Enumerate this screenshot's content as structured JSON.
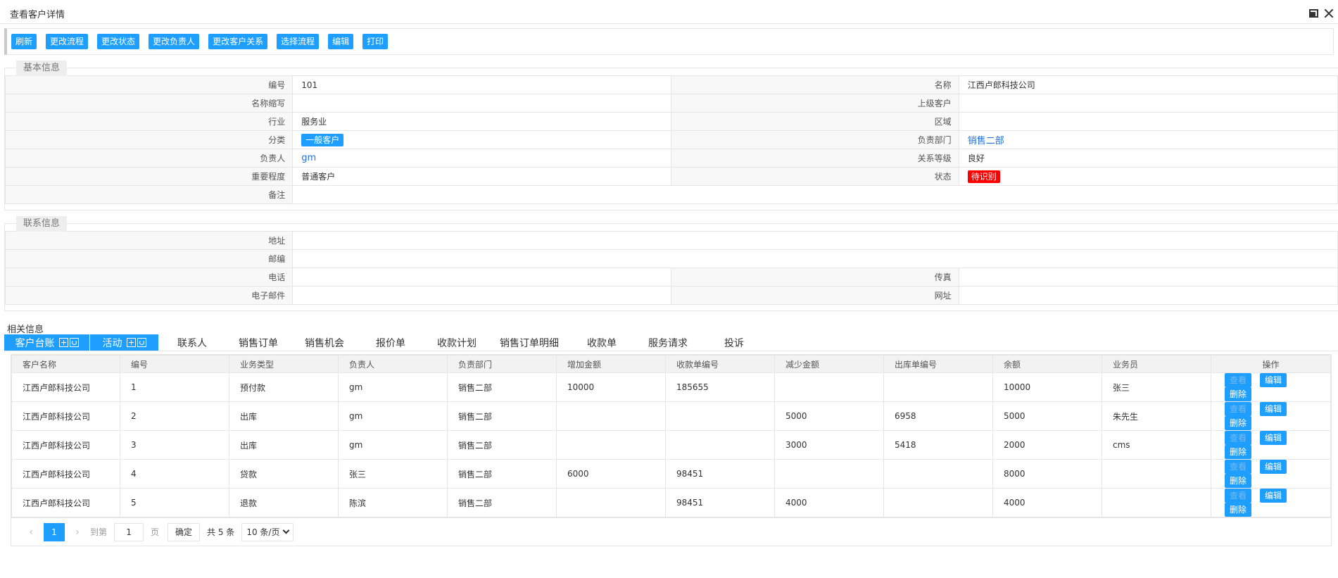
{
  "window": {
    "title": "查看客户详情"
  },
  "toolbar": [
    "刷新",
    "更改流程",
    "更改状态",
    "更改负责人",
    "更改客户关系",
    "选择流程",
    "编辑",
    "打印"
  ],
  "basic": {
    "legend": "基本信息",
    "no_label": "编号",
    "no": "101",
    "name_label": "名称",
    "name": "江西卢郎科技公司",
    "abbr_label": "名称缩写",
    "abbr": "",
    "parent_label": "上级客户",
    "parent": "",
    "industry_label": "行业",
    "industry": "服务业",
    "region_label": "区域",
    "region": "",
    "category_label": "分类",
    "category": "一般客户",
    "dept_label": "负责部门",
    "dept": "销售二部",
    "owner_label": "负责人",
    "owner": "gm",
    "relation_label": "关系等级",
    "relation": "良好",
    "importance_label": "重要程度",
    "importance": "普通客户",
    "status_label": "状态",
    "status": "待识别",
    "remark_label": "备注",
    "remark": ""
  },
  "contact": {
    "legend": "联系信息",
    "address_label": "地址",
    "zip_label": "邮编",
    "phone_label": "电话",
    "fax_label": "传真",
    "email_label": "电子邮件",
    "web_label": "网址"
  },
  "related": {
    "title": "相关信息",
    "tabs": [
      "客户台账",
      "活动",
      "联系人",
      "销售订单",
      "销售机会",
      "报价单",
      "收款计划",
      "销售订单明细",
      "收款单",
      "服务请求",
      "投诉"
    ]
  },
  "grid": {
    "headers": [
      "客户名称",
      "编号",
      "业务类型",
      "负责人",
      "负责部门",
      "增加金额",
      "收款单编号",
      "减少金额",
      "出库单编号",
      "余额",
      "业务员",
      "操作"
    ],
    "rows": [
      [
        "江西卢郎科技公司",
        "1",
        "预付款",
        "gm",
        "销售二部",
        "10000",
        "185655",
        "",
        "",
        "10000",
        "张三"
      ],
      [
        "江西卢郎科技公司",
        "2",
        "出库",
        "gm",
        "销售二部",
        "",
        "",
        "5000",
        "6958",
        "5000",
        "朱先生"
      ],
      [
        "江西卢郎科技公司",
        "3",
        "出库",
        "gm",
        "销售二部",
        "",
        "",
        "3000",
        "5418",
        "2000",
        "cms"
      ],
      [
        "江西卢郎科技公司",
        "4",
        "贷款",
        "张三",
        "销售二部",
        "6000",
        "98451",
        "",
        "",
        "8000",
        ""
      ],
      [
        "江西卢郎科技公司",
        "5",
        "退款",
        "陈滨",
        "销售二部",
        "",
        "98451",
        "4000",
        "",
        "4000",
        ""
      ]
    ],
    "ops": [
      "查看",
      "编辑",
      "删除"
    ]
  },
  "pager": {
    "current": "1",
    "goto_label": "到第",
    "goto_value": "1",
    "unit": "页",
    "ok": "确定",
    "total": "共 5 条",
    "size": "10 条/页"
  }
}
